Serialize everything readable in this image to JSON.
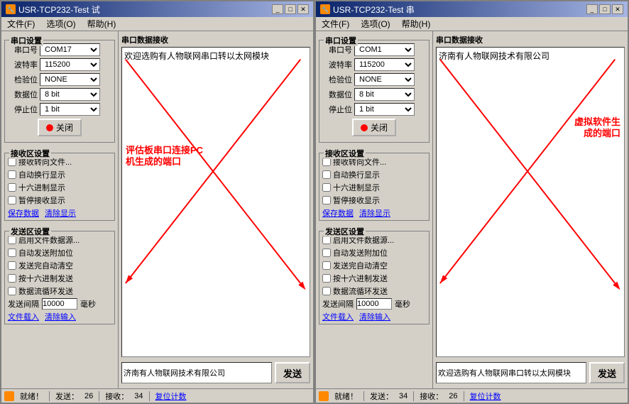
{
  "window1": {
    "title": "USR-TCP232-Test 试",
    "icon": "🔧",
    "menu": [
      "文件(F)",
      "选项(O)",
      "帮助(H)"
    ],
    "serial_settings": {
      "label": "串口设置",
      "port_label": "串口号",
      "port_value": "COM17",
      "baud_label": "波特率",
      "baud_value": "115200",
      "check_label": "检验位",
      "check_value": "NONE",
      "data_label": "数据位",
      "data_value": "8 bit",
      "stop_label": "停止位",
      "stop_value": "1 bit",
      "close_btn": "关闭"
    },
    "recv_section": {
      "label": "接收区设置",
      "cb1": "接收转向文件...",
      "cb2": "自动换行显示",
      "cb3": "十六进制显示",
      "cb4": "暂停接收显示",
      "save_link": "保存数据",
      "clear_link": "清除显示"
    },
    "send_section": {
      "label": "发送区设置",
      "cb1": "启用文件数据源...",
      "cb2": "自动发送附加位",
      "cb3": "发送完自动清空",
      "cb4": "按十六进制发送",
      "cb5": "数据流循环发送",
      "interval_label": "发送间隔",
      "interval_value": "10000",
      "interval_unit": "毫秒",
      "file_link": "文件载入",
      "clear_link": "清除输入"
    },
    "recv_display_text": "欢迎选购有人物联网串口转以太网模块",
    "send_input_value": "济南有人物联网技术有限公司",
    "send_btn": "发送",
    "status": {
      "icon": "🔧",
      "text": "就绪！",
      "send_label": "发送：",
      "send_count": "26",
      "recv_label": "接收：",
      "recv_count": "34",
      "reset_btn": "复位计数"
    },
    "annotation_text": "评估板串口连接PC\n机生成的端口"
  },
  "window2": {
    "title": "USR-TCP232-Test 串",
    "icon": "🔧",
    "menu": [
      "文件(F)",
      "选项(O)",
      "帮助(H)"
    ],
    "serial_settings": {
      "label": "串口设置",
      "port_label": "串口号",
      "port_value": "COM1",
      "baud_label": "波特率",
      "baud_value": "115200",
      "check_label": "检验位",
      "check_value": "NONE",
      "data_label": "数据位",
      "data_value": "8 bit",
      "stop_label": "停止位",
      "stop_value": "1 bit",
      "close_btn": "关闭"
    },
    "recv_section": {
      "label": "接收区设置",
      "cb1": "接收转向文件...",
      "cb2": "自动换行显示",
      "cb3": "十六进制显示",
      "cb4": "暂停接收显示",
      "save_link": "保存数据",
      "clear_link": "清除显示"
    },
    "send_section": {
      "label": "发送区设置",
      "cb1": "启用文件数据源...",
      "cb2": "自动发送附加位",
      "cb3": "发送完自动清空",
      "cb4": "按十六进制发送",
      "cb5": "数据流循环发送",
      "interval_label": "发送间隔",
      "interval_value": "10000",
      "interval_unit": "毫秒",
      "file_link": "文件载入",
      "clear_link": "清除输入"
    },
    "recv_display_text": "济南有人物联网技术有限公司",
    "send_input_value": "欢迎选购有人物联网串口转以太网模块",
    "send_btn": "发送",
    "status": {
      "icon": "🔧",
      "text": "就绪！",
      "send_label": "发送：",
      "send_count": "34",
      "recv_label": "接收：",
      "recv_count": "26",
      "reset_btn": "复位计数"
    },
    "annotation_text": "虚拟软件生\n成的端口"
  }
}
